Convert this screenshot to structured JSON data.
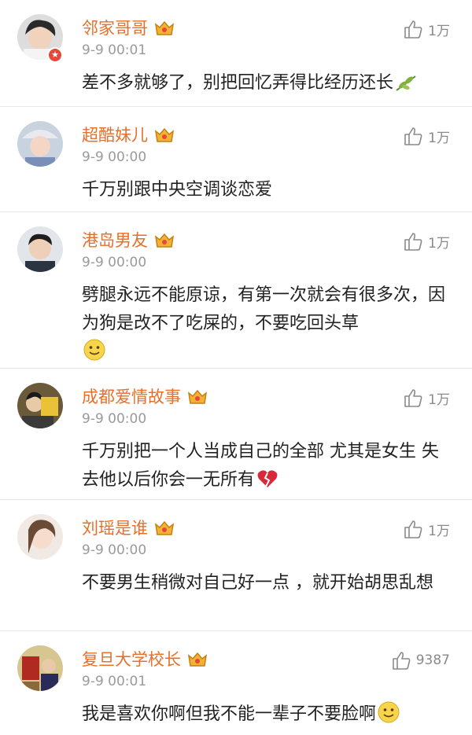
{
  "colors": {
    "username": "#e86f2a",
    "timestamp": "#9a9a9a",
    "body_text": "#222222",
    "like": "#8a8a8a",
    "divider": "#e6e6e6"
  },
  "comments": [
    {
      "username": "邻家哥哥",
      "time": "9-9 00:01",
      "likes": "1万",
      "text": "差不多就够了，别把回忆弄得比经历还长",
      "emoji": "leaf-icon",
      "verified": true
    },
    {
      "username": "超酷妹儿",
      "time": "9-9 00:00",
      "likes": "1万",
      "text": "千万别跟中央空调谈恋爱",
      "emoji": ""
    },
    {
      "username": "港岛男友",
      "time": "9-9 00:00",
      "likes": "1万",
      "text": "劈腿永远不能原谅，有第一次就会有很多次，因为狗是改不了吃屎的，不要吃回头草",
      "emoji": "smile-icon"
    },
    {
      "username": "成都爱情故事",
      "time": "9-9 00:00",
      "likes": "1万",
      "text": "千万别把一个人当成自己的全部 尤其是女生 失去他以后你会一无所有",
      "emoji": "broken-heart-icon"
    },
    {
      "username": "刘瑶是谁",
      "time": "9-9 00:00",
      "likes": "1万",
      "text": "不要男生稍微对自己好一点 ，就开始胡思乱想",
      "emoji": ""
    },
    {
      "username": "复旦大学校长",
      "time": "9-9 00:01",
      "likes": "9387",
      "text": "我是喜欢你啊但我不能一辈子不要脸啊",
      "emoji": "smile-icon"
    }
  ]
}
